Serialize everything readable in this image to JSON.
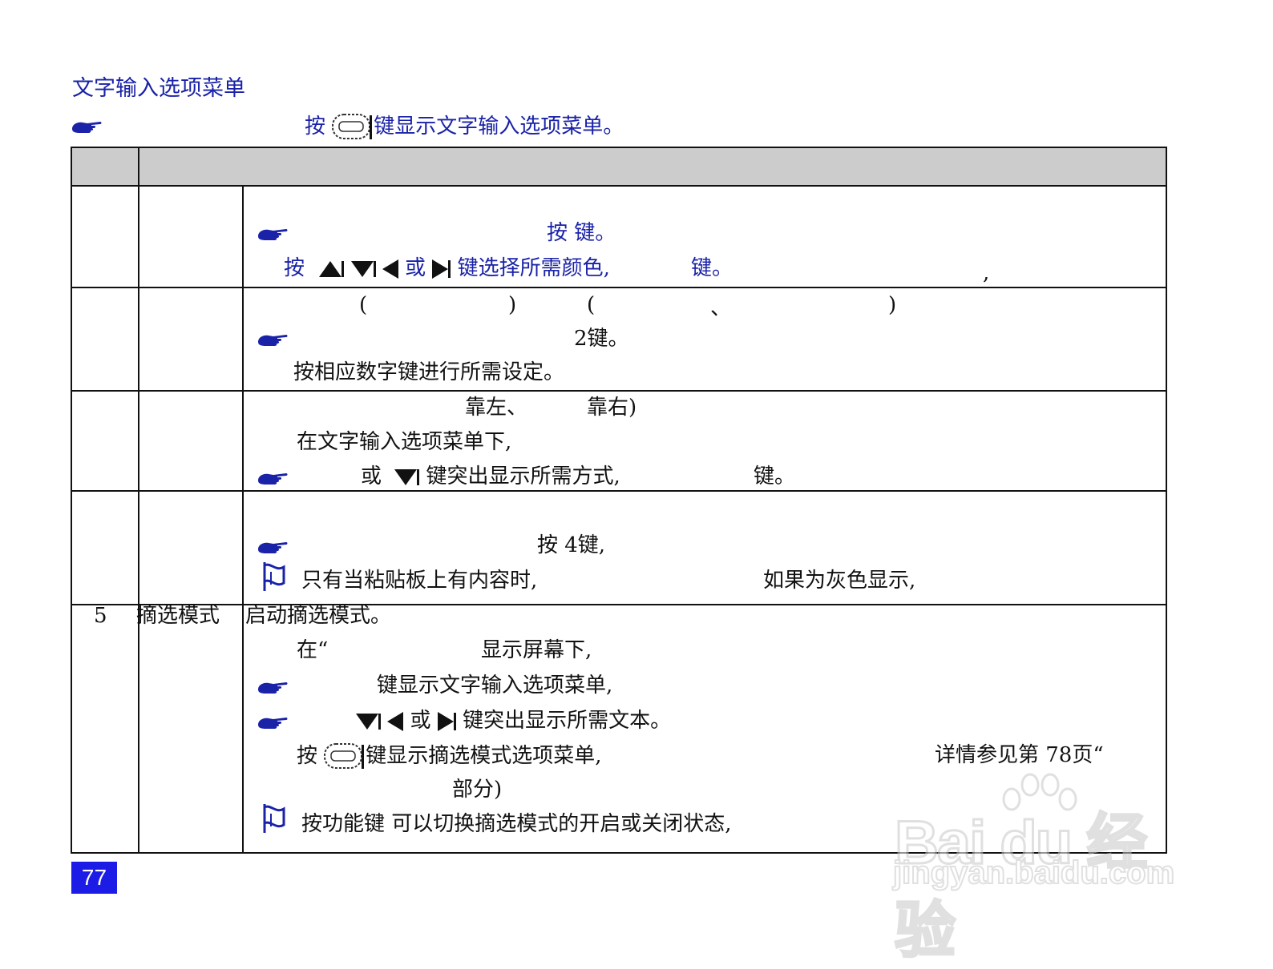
{
  "heading": "文字输入选项菜单",
  "intro": {
    "press": "按",
    "rest": "键显示文字输入选项菜单。"
  },
  "row1": {
    "line1": "按 键。",
    "line2a": "按",
    "line2b": "或",
    "line2c": "键选择所需颜色,",
    "line2d": "键。",
    "line2e": ","
  },
  "row2": {
    "paren1_open": "(",
    "paren1_close": ")",
    "paren2_open": "(",
    "paren2_mid": "、",
    "paren2_close": ")",
    "line2": "2键。",
    "line3": "按相应数字键进行所需设定。"
  },
  "row3": {
    "line1a": "靠左、",
    "line1b": "靠右)",
    "line2": "在文字输入选项菜单下,",
    "line3a": "或",
    "line3b": "键突出显示所需方式,",
    "line3c": "键。"
  },
  "row4": {
    "line1": "按 4键,",
    "line2a": "只有当粘贴板上有内容时,",
    "line2b": "如果为灰色显示,"
  },
  "row5": {
    "num": "5",
    "name": "摘选模式",
    "line1": "启动摘选模式。",
    "line2a": "在“",
    "line2b": "显示屏幕下,",
    "line3": "键显示文字输入选项菜单,",
    "line4a": "或",
    "line4b": "键突出显示所需文本。",
    "line5a": "按",
    "line5b": "键显示摘选模式选项菜单,",
    "line5c": "详情参见第 78页“",
    "line6": "部分)",
    "line7": "按功能键 可以切换摘选模式的开启或关闭状态,"
  },
  "menu_key_label": "menu",
  "page_number": "77",
  "watermark": {
    "line1": "Bai du 经验",
    "line2": "jingyan.baidu.com"
  },
  "colors": {
    "accent_blue": "#1a22a8",
    "header_gray": "#cccccc",
    "page_badge": "#1c1ce6"
  }
}
